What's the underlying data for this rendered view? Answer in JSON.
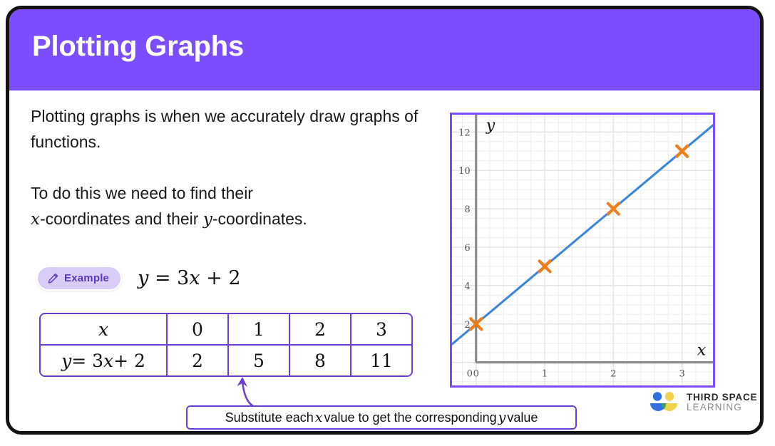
{
  "slide": {
    "header_title": "Plotting Graphs",
    "header_color": "#7c4dff",
    "border_color": "#131313"
  },
  "content": {
    "paragraph1": "Plotting graphs is when we accurately draw graphs of functions.",
    "paragraph2_part1": "To do this we need to find their",
    "paragraph2_var1": "x",
    "paragraph2_part2": "-coordinates and their",
    "paragraph2_var2": "y",
    "paragraph2_part3": "-coordinates."
  },
  "example": {
    "icon": "pencil-icon",
    "label": "Example",
    "equation": "y = 3x + 2",
    "equation_var_y": "y",
    "equation_rest": "= 3",
    "equation_var_x": "x",
    "equation_tail": "+ 2",
    "pill_bg": "#d9ccf7",
    "pill_text_color": "#5b35c4"
  },
  "table": {
    "border_color": "#6c3fd4",
    "row_x_label": "x",
    "row_y_label_y": "y",
    "row_y_label_mid": "= 3",
    "row_y_label_x": "x",
    "row_y_label_tail": "+ 2",
    "x_values": [
      "0",
      "1",
      "2",
      "3"
    ],
    "y_values": [
      "2",
      "5",
      "8",
      "11"
    ]
  },
  "callout": {
    "text_part1": "Substitute each",
    "var1": "x",
    "text_part2": "value to get the corresponding",
    "var2": "y",
    "text_part3": "value",
    "border_color": "#6c3fd4",
    "arrow_color": "#6c3fd4"
  },
  "logo": {
    "line1": "THIRD SPACE",
    "line2": "LEARNING",
    "blue": "#2f6fe0",
    "yellow": "#f2d24b",
    "green": "#34a06a"
  },
  "chart_data": {
    "type": "line",
    "title": "",
    "xlabel": "x",
    "ylabel": "y",
    "equation": "y = 3x + 2",
    "grid": true,
    "legend": "none",
    "xlim": [
      -0.35,
      3.45
    ],
    "ylim": [
      -1.2,
      12.9
    ],
    "xticks": [
      0,
      1,
      2,
      3
    ],
    "xtick_labels": [
      "0",
      "1",
      "2",
      "3"
    ],
    "yticks": [
      0,
      2,
      4,
      6,
      8,
      10,
      12
    ],
    "ytick_labels": [
      "0",
      "2",
      "4",
      "6",
      "8",
      "10",
      "12"
    ],
    "minor_grid_step_x": 0.2,
    "minor_grid_step_y": 0.5,
    "line_color": "#3d85d8",
    "marker_color": "#ef7d1a",
    "axis_color": "#8c8c8c",
    "grid_color": "#e2e2e2",
    "series": [
      {
        "name": "y = 3x + 2",
        "marker": "x",
        "points": [
          {
            "x": 0,
            "y": 2
          },
          {
            "x": 1,
            "y": 5
          },
          {
            "x": 2,
            "y": 8
          },
          {
            "x": 3,
            "y": 11
          }
        ]
      }
    ]
  }
}
